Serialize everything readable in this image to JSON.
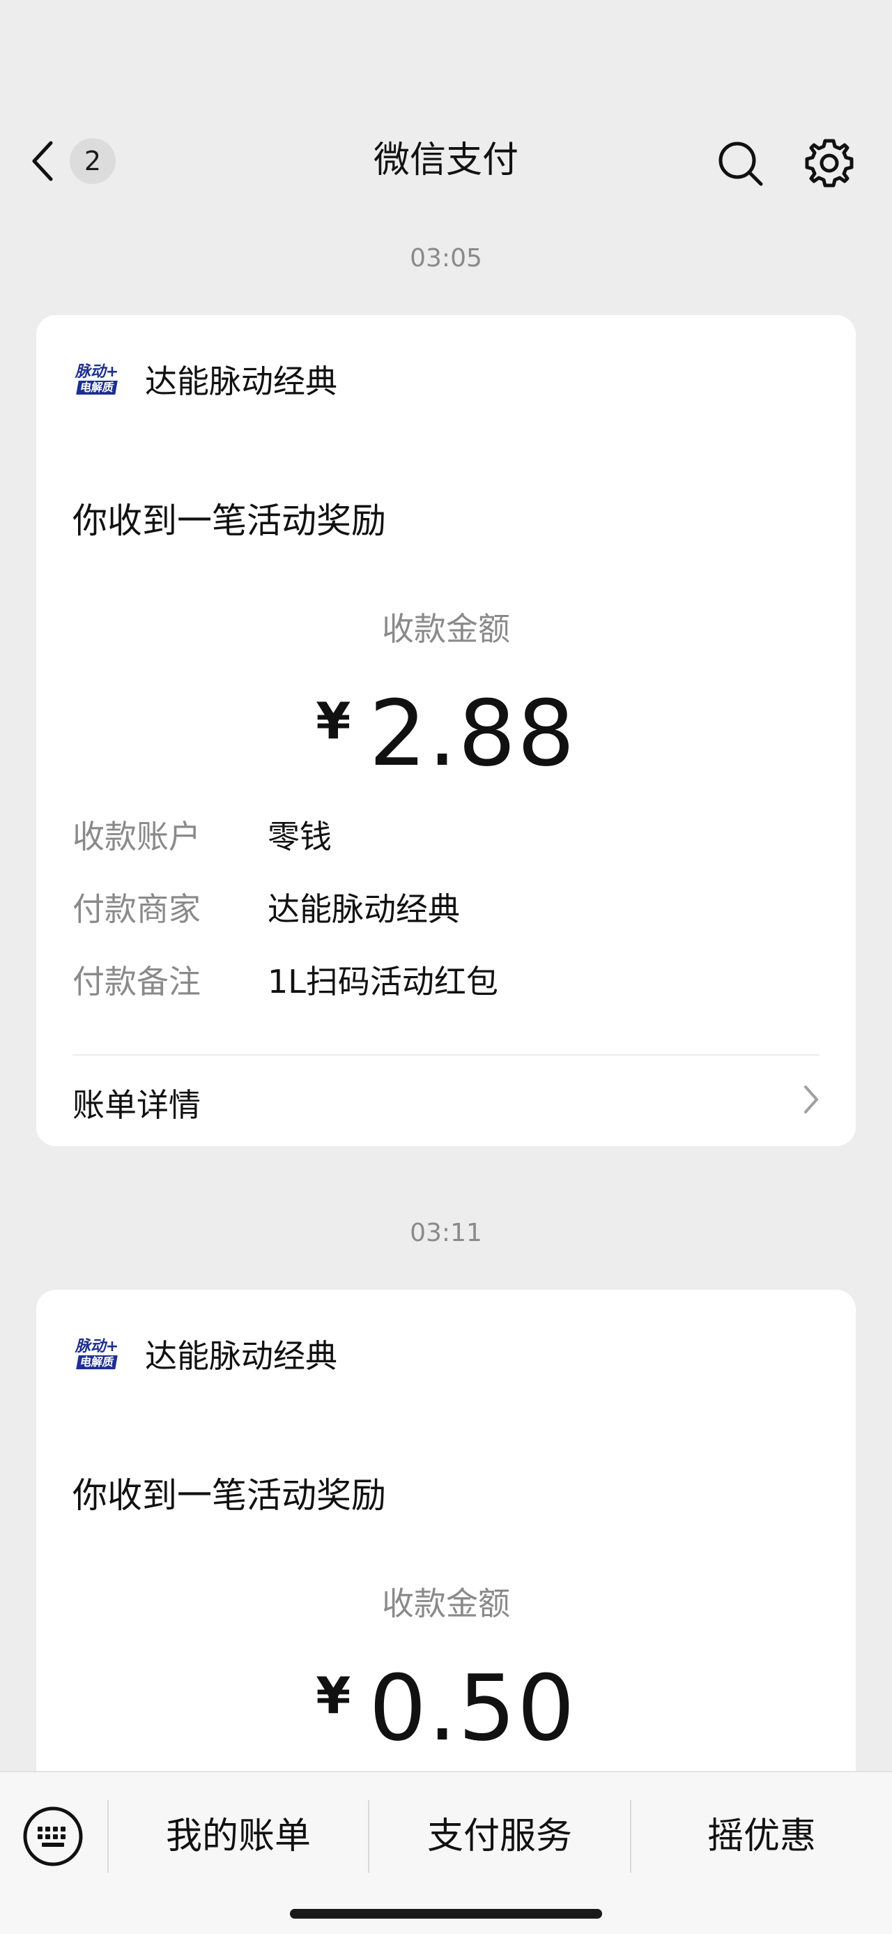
{
  "nav": {
    "title": "微信支付",
    "unread_count": "2",
    "back_icon": "chevron-left-icon",
    "search_icon": "search-icon",
    "settings_icon": "gear-icon"
  },
  "messages": [
    {
      "time": "03:05",
      "merchant_name": "达能脉动经典",
      "logo_text_top": "脉动+",
      "logo_text_bottom": "电解质",
      "headline": "你收到一笔活动奖励",
      "amount_label": "收款金额",
      "currency_symbol": "¥",
      "amount": "2.88",
      "details": [
        {
          "label": "收款账户",
          "value": "零钱"
        },
        {
          "label": "付款商家",
          "value": "达能脉动经典"
        },
        {
          "label": "付款备注",
          "value": "1L扫码活动红包"
        }
      ],
      "bill_link": "账单详情"
    },
    {
      "time": "03:11",
      "merchant_name": "达能脉动经典",
      "logo_text_top": "脉动+",
      "logo_text_bottom": "电解质",
      "headline": "你收到一笔活动奖励",
      "amount_label": "收款金额",
      "currency_symbol": "¥",
      "amount": "0.50"
    }
  ],
  "bottom_menu": {
    "keyboard_icon": "keyboard-icon",
    "items": [
      "我的账单",
      "支付服务",
      "摇优惠"
    ]
  },
  "colors": {
    "background": "#ededed",
    "card": "#ffffff",
    "secondary_text": "#8a8a8a",
    "logo_blue": "#1d2f8f"
  }
}
